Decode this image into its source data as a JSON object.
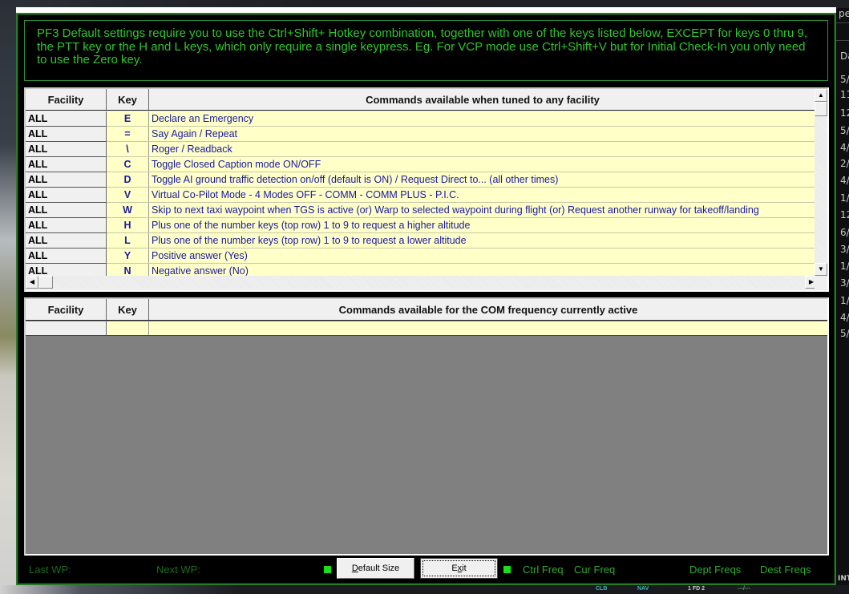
{
  "info_text": "PF3 Default settings require you to use the Ctrl+Shift+ Hotkey combination, together with one of the keys listed below, EXCEPT for keys 0 thru 9, the PTT key or the H and L keys, which only require a single keypress.  Eg. For VCP mode use Ctrl+Shift+V but for Initial Check-In you only need to use the Zero key.",
  "top_table": {
    "headers": {
      "facility": "Facility",
      "key": "Key",
      "commands": "Commands available when tuned to any facility"
    },
    "rows": [
      {
        "facility": "ALL",
        "key": "E",
        "command": "Declare an Emergency"
      },
      {
        "facility": "ALL",
        "key": "=",
        "command": "Say Again / Repeat"
      },
      {
        "facility": "ALL",
        "key": "\\",
        "command": "Roger / Readback"
      },
      {
        "facility": "ALL",
        "key": "C",
        "command": "Toggle Closed Caption mode ON/OFF"
      },
      {
        "facility": "ALL",
        "key": "D",
        "command": "Toggle AI ground traffic detection on/off (default is ON) / Request Direct to... (all other times)"
      },
      {
        "facility": "ALL",
        "key": "V",
        "command": "Virtual Co-Pilot Mode - 4 Modes OFF - COMM - COMM PLUS - P.I.C."
      },
      {
        "facility": "ALL",
        "key": "W",
        "command": "Skip to next taxi waypoint when TGS is active (or) Warp to selected waypoint during flight (or) Request another runway for takeoff/landing"
      },
      {
        "facility": "ALL",
        "key": "H",
        "command": "Plus one of the number keys (top row) 1 to 9 to request a higher altitude"
      },
      {
        "facility": "ALL",
        "key": "L",
        "command": "Plus one of the number keys (top row) 1 to 9 to request a lower altitude"
      },
      {
        "facility": "ALL",
        "key": "Y",
        "command": "Positive answer (Yes)"
      },
      {
        "facility": "ALL",
        "key": "N",
        "command": "Negative answer (No)"
      }
    ],
    "scroll_up": "▲",
    "scroll_down": "▼",
    "scroll_left": "◀",
    "scroll_right": "▶"
  },
  "bottom_table": {
    "headers": {
      "facility": "Facility",
      "key": "Key",
      "commands": "Commands available for the COM frequency currently active"
    },
    "rows": [
      {
        "facility": "",
        "key": "",
        "command": ""
      }
    ]
  },
  "footer": {
    "last_wp": "Last WP:",
    "next_wp": "Next WP:",
    "default_size_mnemonic": "D",
    "default_size_rest": "efault Size",
    "exit_pre": "E",
    "exit_mnemonic": "x",
    "exit_post": "it",
    "ctrl_freq": "Ctrl Freq",
    "cur_freq": "Cur Freq",
    "dept_freqs": "Dept Freqs",
    "dest_freqs": "Dest Freqs",
    "led_color": "#18e018"
  },
  "background": {
    "right_panel_header": "pe",
    "right_panel_col": "Da",
    "right_panel_items": [
      "5/",
      "11",
      "12",
      "5/",
      "4/",
      "2/",
      "4/",
      "1/",
      "12",
      "6/",
      "3/",
      "1/",
      "3/",
      "1/",
      "4/",
      "5/"
    ],
    "right_panel_bottom": "INT",
    "cockpit_labels": [
      "CLB",
      "NAV",
      "1 FD 2",
      "---/---"
    ]
  }
}
